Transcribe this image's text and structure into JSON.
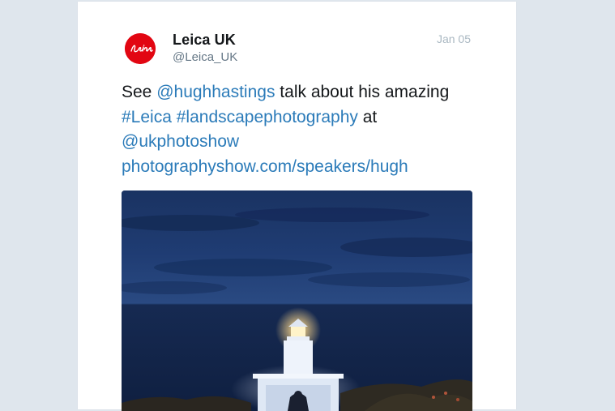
{
  "tweet": {
    "author_name": "Leica UK",
    "author_handle": "@Leica_UK",
    "date": "Jan 05",
    "avatar_logo_text": "Leica",
    "text": {
      "line1_prefix": "See ",
      "mention1": "@hughhastings",
      "line1_suffix": " talk about his amazing",
      "hashtag1": "#Leica",
      "space": " ",
      "hashtag2": "#landscapephotography",
      "line2_suffix": " at",
      "mention2": "@ukphotoshow",
      "url": "photographyshow.com/speakers/hugh"
    },
    "media": {
      "icon": "photo-lighthouse-night"
    }
  },
  "colors": {
    "link": "#2b7bb9",
    "brand_red": "#e20612",
    "background": "#dfe6ed"
  }
}
